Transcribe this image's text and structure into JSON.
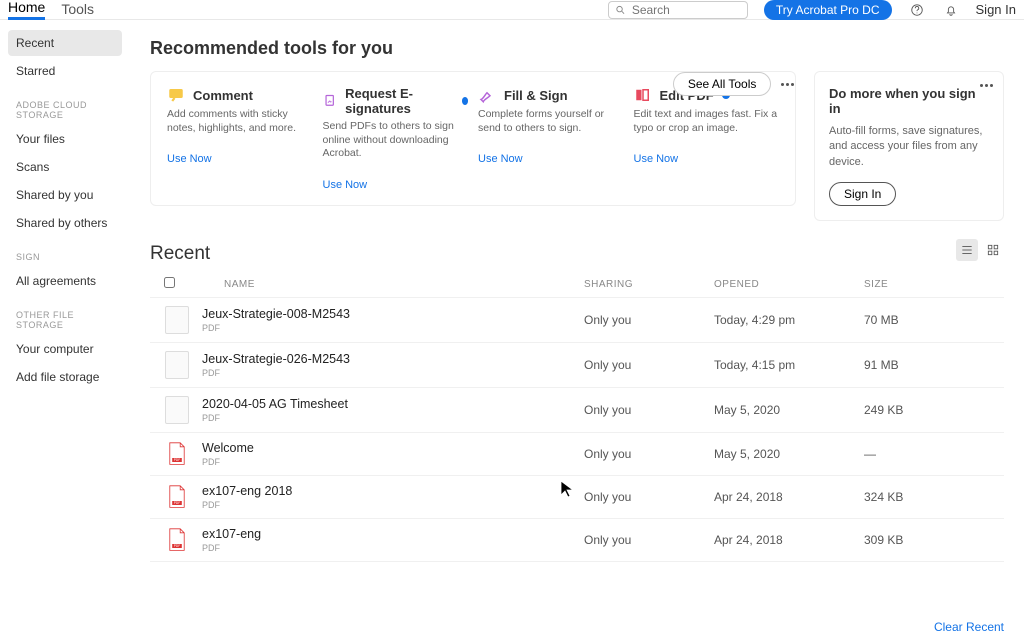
{
  "topbar": {
    "home": "Home",
    "tools": "Tools",
    "search_placeholder": "Search",
    "try_pro": "Try Acrobat Pro DC",
    "sign_in": "Sign In"
  },
  "sidebar": {
    "recent": "Recent",
    "starred": "Starred",
    "head_cloud": "ADOBE CLOUD STORAGE",
    "your_files": "Your files",
    "scans": "Scans",
    "shared_by_you": "Shared by you",
    "shared_by_others": "Shared by others",
    "head_sign": "SIGN",
    "all_agreements": "All agreements",
    "head_other": "OTHER FILE STORAGE",
    "your_computer": "Your computer",
    "add_file_storage": "Add file storage"
  },
  "rec": {
    "heading": "Recommended tools for you",
    "see_all": "See All Tools",
    "use_now": "Use Now",
    "cards": [
      {
        "title": "Comment",
        "desc": "Add comments with sticky notes, highlights, and more."
      },
      {
        "title": "Request E-signatures",
        "desc": "Send PDFs to others to sign online without downloading Acrobat."
      },
      {
        "title": "Fill & Sign",
        "desc": "Complete forms yourself or send to others to sign."
      },
      {
        "title": "Edit PDF",
        "desc": "Edit text and images fast. Fix a typo or crop an image."
      }
    ]
  },
  "right": {
    "title": "Do more when you sign in",
    "body": "Auto-fill forms, save signatures, and access your files from any device.",
    "sign_in": "Sign In"
  },
  "recent_label": "Recent",
  "columns": {
    "name": "NAME",
    "sharing": "SHARING",
    "opened": "OPENED",
    "size": "SIZE"
  },
  "files": [
    {
      "name": "Jeux-Strategie-008-M2543",
      "type": "PDF",
      "sharing": "Only you",
      "opened": "Today, 4:29 pm",
      "size": "70 MB",
      "thumb": "img"
    },
    {
      "name": "Jeux-Strategie-026-M2543",
      "type": "PDF",
      "sharing": "Only you",
      "opened": "Today, 4:15 pm",
      "size": "91 MB",
      "thumb": "img"
    },
    {
      "name": "2020-04-05 AG Timesheet",
      "type": "PDF",
      "sharing": "Only you",
      "opened": "May 5, 2020",
      "size": "249 KB",
      "thumb": "img"
    },
    {
      "name": "Welcome",
      "type": "PDF",
      "sharing": "Only you",
      "opened": "May 5, 2020",
      "size": "—",
      "thumb": "pdf"
    },
    {
      "name": "ex107-eng 2018",
      "type": "PDF",
      "sharing": "Only you",
      "opened": "Apr 24, 2018",
      "size": "324 KB",
      "thumb": "pdf"
    },
    {
      "name": "ex107-eng",
      "type": "PDF",
      "sharing": "Only you",
      "opened": "Apr 24, 2018",
      "size": "309 KB",
      "thumb": "pdf"
    }
  ],
  "clear_recent": "Clear Recent"
}
